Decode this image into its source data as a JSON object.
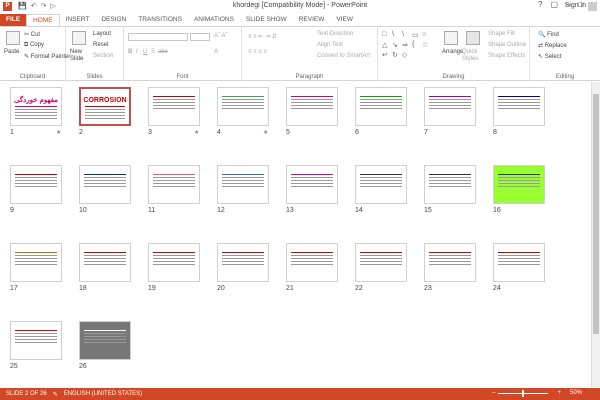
{
  "window": {
    "title": "khordegi [Compatibility Mode] - PowerPoint",
    "app_icon": "P"
  },
  "tabs": [
    "FILE",
    "HOME",
    "INSERT",
    "DESIGN",
    "TRANSITIONS",
    "ANIMATIONS",
    "SLIDE SHOW",
    "REVIEW",
    "VIEW"
  ],
  "signin": "Sign in",
  "ribbon": {
    "clipboard": {
      "label": "Clipboard",
      "paste": "Paste",
      "cut": "Cut",
      "copy": "Copy",
      "format_painter": "Format Painter"
    },
    "slides": {
      "label": "Slides",
      "new_slide": "New Slide",
      "layout": "Layout",
      "reset": "Reset",
      "section": "Section"
    },
    "font": {
      "label": "Font"
    },
    "paragraph": {
      "label": "Paragraph",
      "text_direction": "Text Direction",
      "align_text": "Align Text",
      "convert": "Convert to SmartArt"
    },
    "drawing": {
      "label": "Drawing",
      "arrange": "Arrange",
      "quick_styles": "Quick Styles",
      "shape_fill": "Shape Fill",
      "shape_outline": "Shape Outline",
      "shape_effects": "Shape Effects"
    },
    "editing": {
      "label": "Editing",
      "find": "Find",
      "replace": "Replace",
      "select": "Select"
    }
  },
  "slides": [
    {
      "n": "1",
      "star": true,
      "title": "مفهوم خوردگی",
      "sub": "",
      "bg": "#fff",
      "tc": "#d4006a"
    },
    {
      "n": "2",
      "star": false,
      "title": "CORROSION",
      "sub": "",
      "bg": "#fff",
      "tc": "#c00"
    },
    {
      "n": "3",
      "star": true,
      "title": "",
      "sub": "",
      "bg": "#fff",
      "tc": "#c00"
    },
    {
      "n": "4",
      "star": true,
      "title": "",
      "sub": "",
      "bg": "#fff",
      "tc": "#3a5"
    },
    {
      "n": "5",
      "star": false,
      "title": "",
      "sub": "",
      "bg": "#fff",
      "tc": "#d4006a"
    },
    {
      "n": "6",
      "star": false,
      "title": "",
      "sub": "",
      "bg": "#fff",
      "tc": "#0a0"
    },
    {
      "n": "7",
      "star": false,
      "title": "",
      "sub": "",
      "bg": "#fff",
      "tc": "#90c"
    },
    {
      "n": "8",
      "star": false,
      "title": "",
      "sub": "",
      "bg": "#fff",
      "tc": "#00a"
    },
    {
      "n": "9",
      "star": false,
      "title": "",
      "sub": "",
      "bg": "#fff",
      "tc": "#c00"
    },
    {
      "n": "10",
      "star": false,
      "title": "",
      "sub": "",
      "bg": "#fff",
      "tc": "#036"
    },
    {
      "n": "11",
      "star": false,
      "title": "",
      "sub": "",
      "bg": "#fff",
      "tc": "#c66"
    },
    {
      "n": "12",
      "star": false,
      "title": "",
      "sub": "",
      "bg": "#fff",
      "tc": "#36c"
    },
    {
      "n": "13",
      "star": false,
      "title": "",
      "sub": "",
      "bg": "#fff",
      "tc": "#c0c"
    },
    {
      "n": "14",
      "star": false,
      "title": "",
      "sub": "",
      "bg": "#fff",
      "tc": "#333"
    },
    {
      "n": "15",
      "star": false,
      "title": "",
      "sub": "",
      "bg": "#fff",
      "tc": "#333"
    },
    {
      "n": "16",
      "star": false,
      "title": "",
      "sub": "",
      "bg": "#9f3",
      "tc": "#333"
    },
    {
      "n": "17",
      "star": false,
      "title": "",
      "sub": "",
      "bg": "#fff",
      "tc": "#c60"
    },
    {
      "n": "18",
      "star": false,
      "title": "",
      "sub": "",
      "bg": "#fff",
      "tc": "#c00"
    },
    {
      "n": "19",
      "star": false,
      "title": "",
      "sub": "",
      "bg": "#fff",
      "tc": "#c00"
    },
    {
      "n": "20",
      "star": false,
      "title": "",
      "sub": "",
      "bg": "#fff",
      "tc": "#c00"
    },
    {
      "n": "21",
      "star": false,
      "title": "",
      "sub": "",
      "bg": "#fff",
      "tc": "#c00"
    },
    {
      "n": "22",
      "star": false,
      "title": "",
      "sub": "",
      "bg": "#fff",
      "tc": "#c00"
    },
    {
      "n": "23",
      "star": false,
      "title": "",
      "sub": "",
      "bg": "#fff",
      "tc": "#c00"
    },
    {
      "n": "24",
      "star": false,
      "title": "",
      "sub": "",
      "bg": "#fff",
      "tc": "#c00"
    },
    {
      "n": "25",
      "star": false,
      "title": "",
      "sub": "",
      "bg": "#fff",
      "tc": "#c00"
    },
    {
      "n": "26",
      "star": false,
      "title": "",
      "sub": "",
      "bg": "#777",
      "tc": "#fff"
    }
  ],
  "status": {
    "slide_info": "SLIDE 2 OF 26",
    "language": "ENGLISH (UNITED STATES)",
    "zoom": "50%"
  }
}
